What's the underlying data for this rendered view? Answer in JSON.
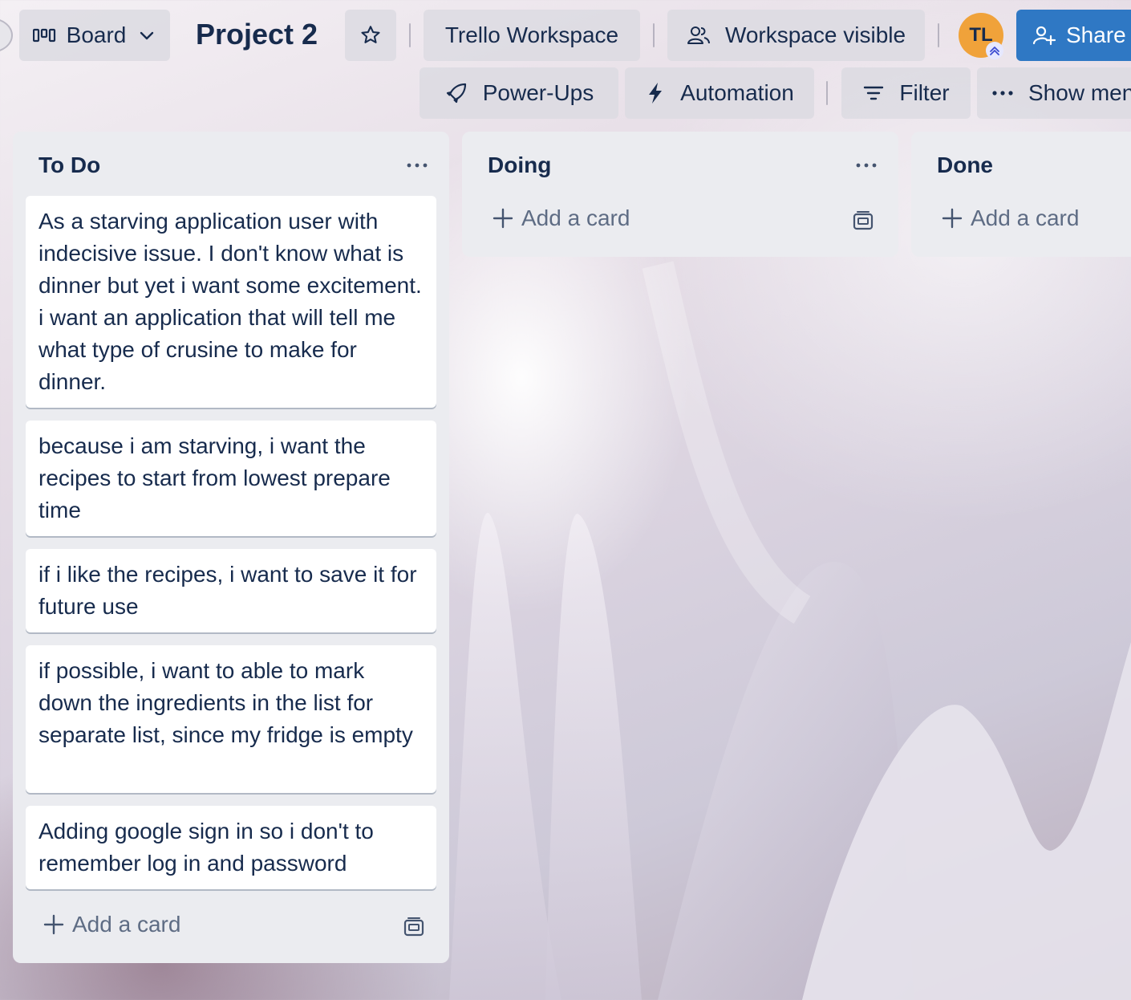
{
  "header": {
    "view_label": "Board",
    "board_title": "Project 2",
    "workspace_label": "Trello Workspace",
    "visibility_label": "Workspace visible",
    "avatar_initials": "TL",
    "share_label": "Share",
    "powerups_label": "Power-Ups",
    "automation_label": "Automation",
    "filter_label": "Filter",
    "show_menu_label": "Show men"
  },
  "lists": [
    {
      "title": "To Do",
      "cards": [
        "As a starving application user with indecisive issue. I don't know what is dinner but yet i want some excitement. i want an application that will tell me what type of crusine to make for dinner.",
        "because i am starving, i want the recipes to start from lowest prepare time",
        "if i like the recipes, i want to save it for future use",
        "if possible, i want to able to mark down the ingredients in the list for separate list, since my fridge is empty",
        "Adding google sign in so i don't to remember log in and password"
      ],
      "add_card_label": "Add a card"
    },
    {
      "title": "Doing",
      "cards": [],
      "add_card_label": "Add a card"
    },
    {
      "title": "Done",
      "cards": [],
      "add_card_label": "Add a card"
    }
  ],
  "colors": {
    "share_button": "#2f78c4",
    "avatar": "#f0a23a",
    "list_bg": "#ebecf0",
    "text": "#172b4d"
  }
}
